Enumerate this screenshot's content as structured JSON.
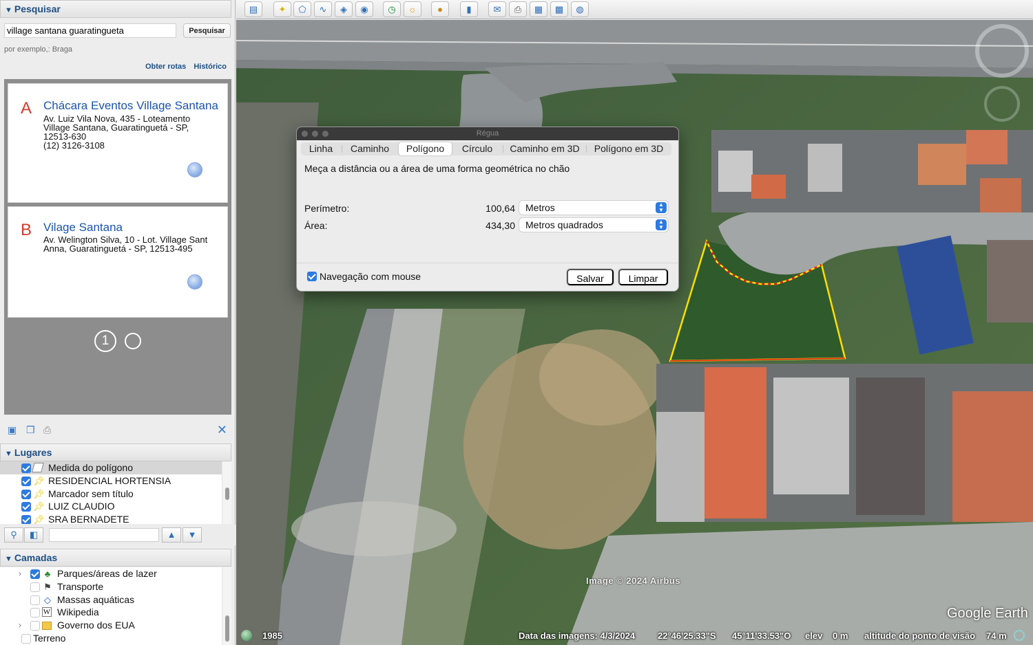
{
  "search": {
    "header": "Pesquisar",
    "query": "village santana guaratingueta",
    "button": "Pesquisar",
    "hint": "por exemplo,: Braga",
    "links": [
      "Obter rotas",
      "Histórico"
    ]
  },
  "results": [
    {
      "letter": "A",
      "name": "Chácara Eventos Village Santana",
      "address": "Av. Luiz Vila Nova, 435 - Loteamento Village Santana, Guaratinguetá - SP, 12513-630",
      "phone": "(12) 3126-3108"
    },
    {
      "letter": "B",
      "name": "Vilage Santana",
      "address": "Av. Welington Silva, 10 - Lot. Village Sant Anna, Guaratinguetá - SP, 12513-495",
      "phone": ""
    }
  ],
  "pager": [
    "1",
    ""
  ],
  "places": {
    "header": "Lugares",
    "items": [
      {
        "label": "Medida do polígono",
        "icon": "polygon-icon",
        "checked": true
      },
      {
        "label": "RESIDENCIAL HORTENSIA",
        "icon": "pushpin-icon",
        "checked": true
      },
      {
        "label": "Marcador sem título",
        "icon": "pushpin-icon",
        "checked": true
      },
      {
        "label": "LUIZ CLAUDIO",
        "icon": "pushpin-icon",
        "checked": true
      },
      {
        "label": "SRA BERNADETE",
        "icon": "pushpin-icon",
        "checked": true
      }
    ]
  },
  "layers": {
    "header": "Camadas",
    "items": [
      {
        "label": "Parques/áreas de lazer",
        "icon": "tree-icon",
        "checked": true
      },
      {
        "label": "Transporte",
        "icon": "transport-icon",
        "checked": false
      },
      {
        "label": "Massas aquáticas",
        "icon": "water-icon",
        "checked": false
      },
      {
        "label": "Wikipedia",
        "icon": "wikipedia-icon",
        "checked": false
      },
      {
        "label": "Governo dos EUA",
        "icon": "folder-icon",
        "checked": false
      },
      {
        "label": "Terreno",
        "icon": "",
        "checked": false
      }
    ]
  },
  "ruler": {
    "title": "Régua",
    "tabs": [
      "Linha",
      "Caminho",
      "Polígono",
      "Círculo",
      "Caminho em 3D",
      "Polígono em 3D"
    ],
    "active_tab": "Polígono",
    "description": "Meça a distância ou a área de uma forma geométrica no chão",
    "perimeter_label": "Perímetro:",
    "perimeter_value": "100,64",
    "perimeter_unit": "Metros",
    "area_label": "Área:",
    "area_value": "434,30",
    "area_unit": "Metros quadrados",
    "mouse_nav_label": "Navegação com mouse",
    "mouse_nav_checked": true,
    "save": "Salvar",
    "clear": "Limpar"
  },
  "status": {
    "year": "1985",
    "image_date": "Data das imagens: 4/3/2024",
    "lat": "22°46'25.33\"S",
    "lon": "45°11'33.53\"O",
    "elev_label": "elev",
    "elev": "0 m",
    "eye_alt_label": "altitude do ponto de visão",
    "eye_alt": "74 m"
  },
  "credit": "Image © 2024 Airbus",
  "brand": "Google Earth",
  "colors": {
    "accent": "#2d7ae0",
    "link": "#1a55a8",
    "marker_letter": "#d53b2b",
    "polygon_stroke": "#ffe000",
    "polygon_dash": "#e21b1b"
  }
}
